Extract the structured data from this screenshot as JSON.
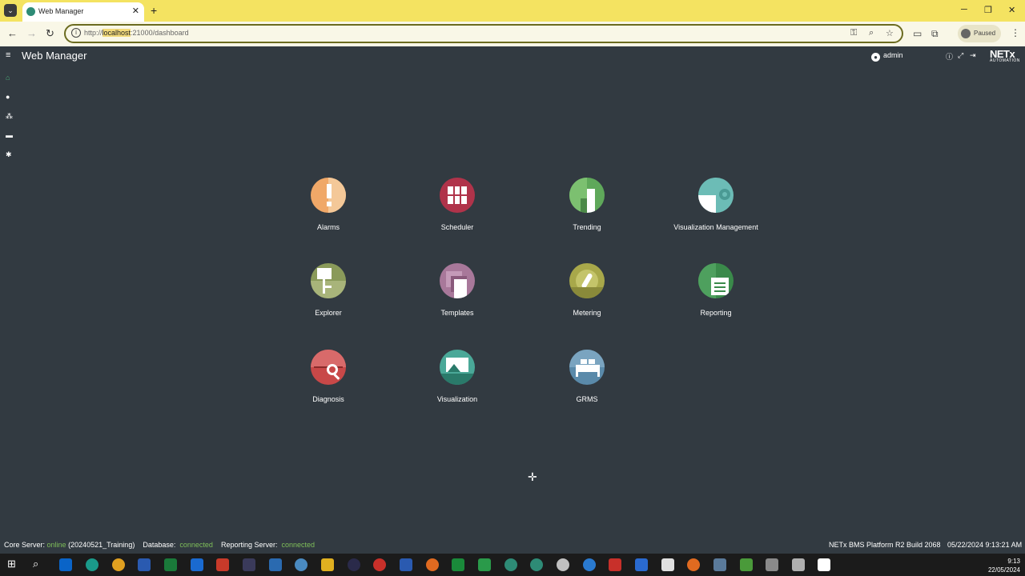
{
  "browser": {
    "tab_title": "Web Manager",
    "url_scheme": "http://",
    "url_host": "localhost",
    "url_path": ":21000/dashboard",
    "profile_status": "Paused"
  },
  "app": {
    "title": "Web Manager",
    "user": "admin",
    "logo_text": "NETx",
    "logo_sub": "AUTOMATION"
  },
  "tiles": [
    {
      "label": "Alarms",
      "color": "#f0a868",
      "icon": "alarm-icon"
    },
    {
      "label": "Scheduler",
      "color": "#b0334a",
      "icon": "scheduler-icon"
    },
    {
      "label": "Trending",
      "color": "#5fa85a",
      "icon": "trending-icon"
    },
    {
      "label": "Visualization Management",
      "color": "#6cbcb6",
      "icon": "gear-icon"
    },
    {
      "label": "Explorer",
      "color": "#8a9a5a",
      "icon": "explorer-icon"
    },
    {
      "label": "Templates",
      "color": "#a8789a",
      "icon": "templates-icon"
    },
    {
      "label": "Metering",
      "color": "#a8a84a",
      "icon": "gauge-icon"
    },
    {
      "label": "Reporting",
      "color": "#3a8a4a",
      "icon": "report-icon"
    },
    {
      "label": "Diagnosis",
      "color": "#c84848",
      "icon": "diagnosis-icon"
    },
    {
      "label": "Visualization",
      "color": "#4aa898",
      "icon": "visualization-icon"
    },
    {
      "label": "GRMS",
      "color": "#5a8aaa",
      "icon": "bed-icon"
    }
  ],
  "status": {
    "core_label": "Core Server:",
    "core_state": "online",
    "core_detail": "(20240521_Training)",
    "db_label": "Database:",
    "db_state": "connected",
    "rep_label": "Reporting Server:",
    "rep_state": "connected",
    "build": "NETx BMS Platform R2 Build 2068",
    "datetime": "05/22/2024 9:13:21 AM"
  },
  "taskbar": {
    "time": "9:13",
    "date": "22/05/2024"
  }
}
